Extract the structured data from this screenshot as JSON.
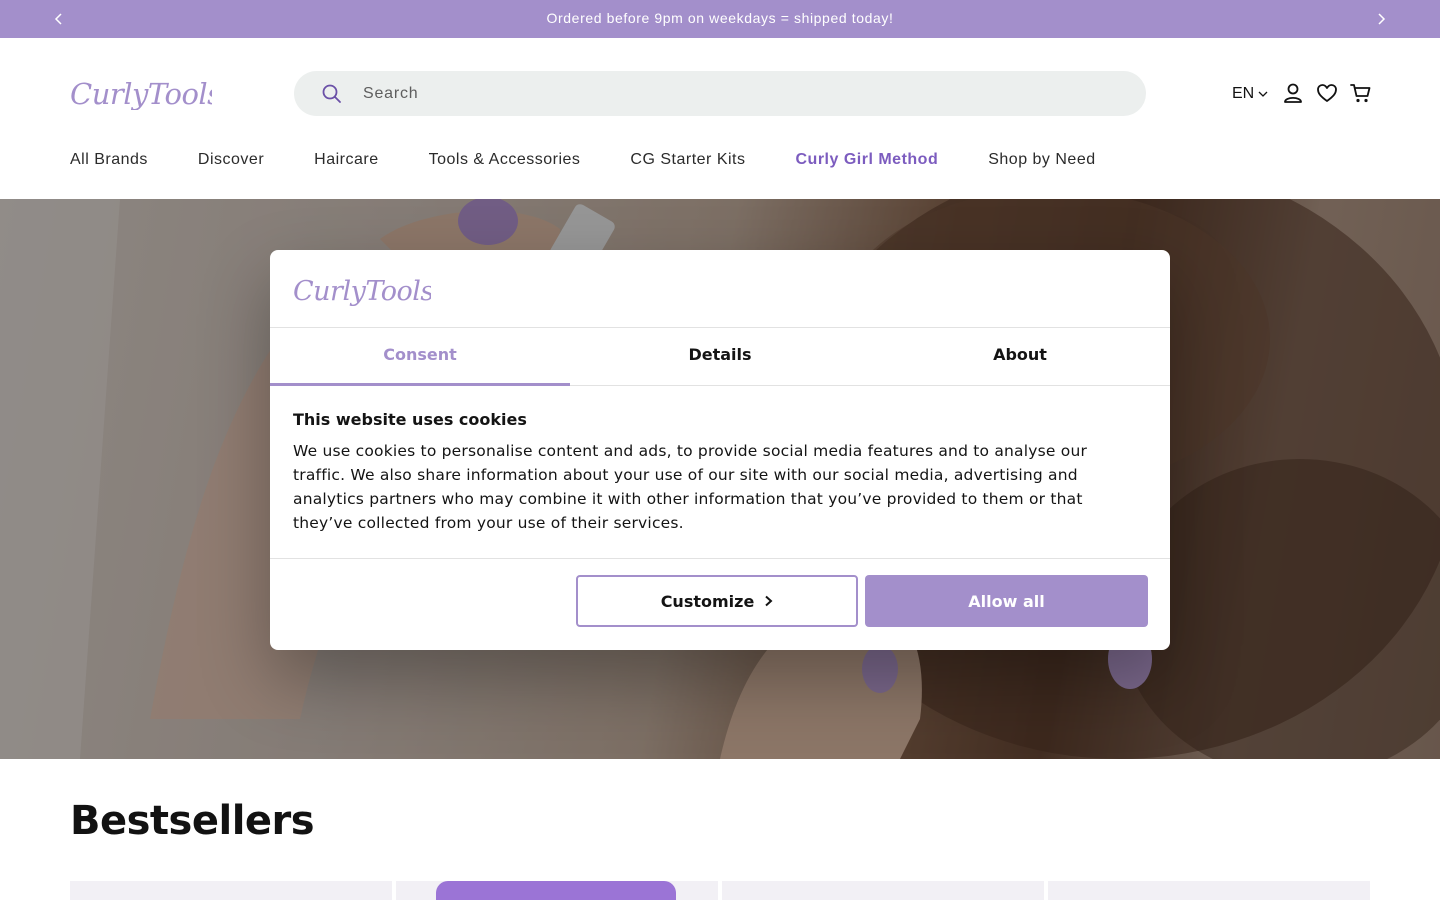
{
  "announcement": {
    "text": "Ordered before 9pm on weekdays = shipped today!",
    "prev_icon": "chevron-left-icon",
    "next_icon": "chevron-right-icon"
  },
  "header": {
    "logo_text": "CurlyTools",
    "search_placeholder": "Search",
    "language": "EN",
    "icons": [
      "search-icon",
      "chevron-down-icon",
      "account-icon",
      "heart-icon",
      "cart-icon"
    ]
  },
  "nav": {
    "items": [
      {
        "label": "All Brands"
      },
      {
        "label": "Discover"
      },
      {
        "label": "Haircare"
      },
      {
        "label": "Tools & Accessories"
      },
      {
        "label": "CG Starter Kits"
      },
      {
        "label": "Curly Girl Method"
      },
      {
        "label": "Shop by Need"
      }
    ]
  },
  "section": {
    "title": "Bestsellers"
  },
  "cookie_dialog": {
    "logo_text": "CurlyTools",
    "tabs": [
      {
        "label": "Consent",
        "active": true
      },
      {
        "label": "Details",
        "active": false
      },
      {
        "label": "About",
        "active": false
      }
    ],
    "title": "This website uses cookies",
    "body": "We use cookies to personalise content and ads, to provide social media features and to analyse our traffic. We also share information about your use of our site with our social media, advertising and analytics partners who may combine it with other information that you’ve provided to them or that they’ve collected from your use of their services.",
    "customize_label": "Customize",
    "allow_label": "Allow all"
  },
  "colors": {
    "brand": "#a38fcb",
    "nav_accent": "#7c5cbf",
    "search_bg": "#ecefee"
  }
}
